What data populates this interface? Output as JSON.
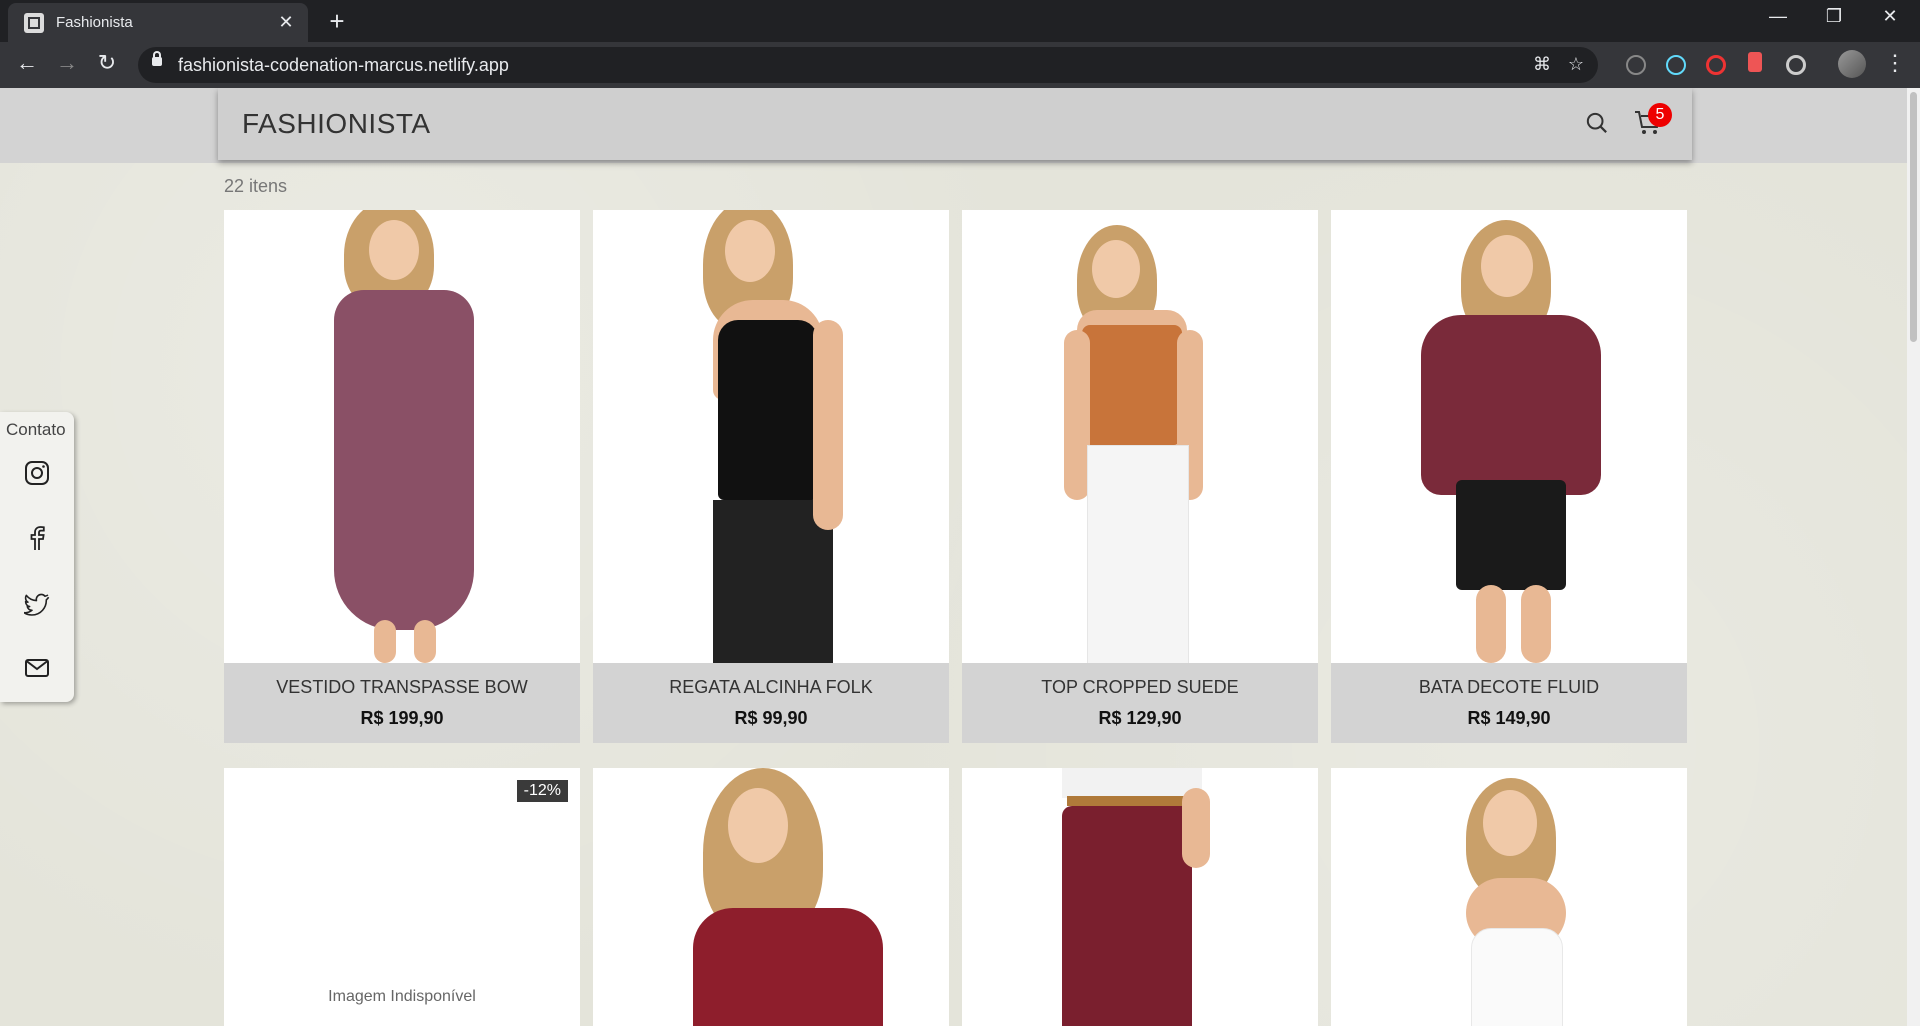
{
  "browser": {
    "tab_title": "Fashionista",
    "close_tab": "✕",
    "new_tab": "+",
    "url": "fashionista-codenation-marcus.netlify.app",
    "window_controls": {
      "minimize": "—",
      "restore": "❐",
      "close": "✕"
    }
  },
  "header": {
    "brand": "FASHIONISTA",
    "cart_count": "5"
  },
  "catalog": {
    "count_label": "22 itens",
    "products": [
      {
        "name": "VESTIDO TRANSPASSE BOW",
        "price": "R$ 199,90"
      },
      {
        "name": "REGATA ALCINHA FOLK",
        "price": "R$ 99,90"
      },
      {
        "name": "TOP CROPPED SUEDE",
        "price": "R$ 129,90"
      },
      {
        "name": "BATA DECOTE FLUID",
        "price": "R$ 149,90"
      },
      {
        "discount": "-12%",
        "unavailable": "Imagem Indisponível"
      },
      {},
      {},
      {}
    ]
  },
  "contact": {
    "title": "Contato",
    "icons": [
      "instagram-icon",
      "facebook-icon",
      "twitter-icon",
      "mail-icon"
    ]
  },
  "colors": {
    "header_bg": "#cfcfcf",
    "badge": "#ee0000",
    "card_info_bg": "#d3d3d3"
  }
}
